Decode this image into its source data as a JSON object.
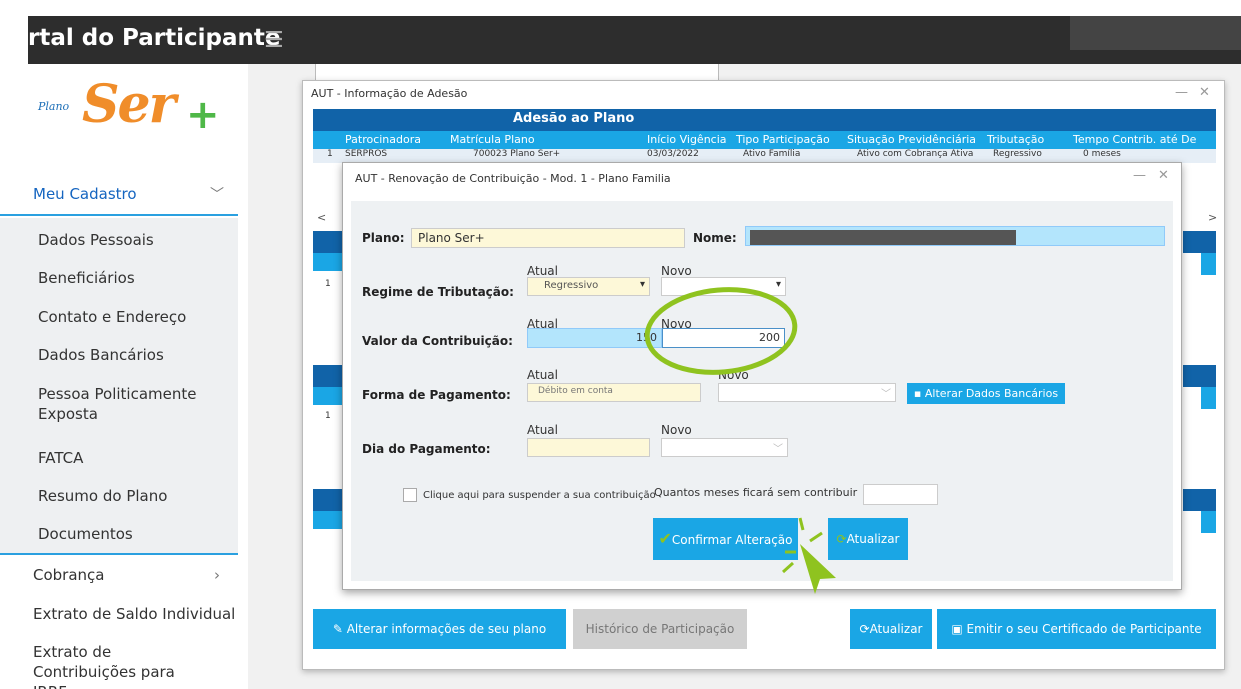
{
  "header": {
    "title": "rtal do Participante",
    "menu_icon": "hamburger-icon"
  },
  "logo": {
    "small": "Plano",
    "big": "Ser",
    "plus": "+"
  },
  "sidebar": {
    "section": "Meu Cadastro",
    "items": [
      "Dados Pessoais",
      "Beneficiários",
      "Contato e Endereço",
      "Dados Bancários",
      "Pessoa Politicamente Exposta",
      "FATCA",
      "Resumo do Plano",
      "Documentos"
    ],
    "cobranca": "Cobrança",
    "extrato_saldo": "Extrato de Saldo Individual",
    "extrato_contrib": "Extrato de Contribuições para IRRF"
  },
  "outer_window": {
    "title": "AUT - Informação de Adesão",
    "header": "Adesão ao Plano",
    "columns": [
      "Patrocinadora",
      "Matrícula Plano",
      "Início Vigência",
      "Tipo Participação",
      "Situação Previdênciária",
      "Tributação",
      "Tempo Contrib. até De"
    ],
    "row": [
      "1",
      "SERPROS",
      "700023 Plano Ser+",
      "03/03/2022",
      "Ativo Família",
      "Ativo com Cobrança Ativa",
      "Regressivo",
      "0 meses"
    ],
    "row_num_2": "1",
    "row_num_3": "1",
    "btn_alterar": "Alterar informações de seu plano",
    "btn_historico": "Histórico de Participação",
    "btn_atualizar": "Atualizar",
    "btn_certificado": "Emitir o seu Certificado de Participante"
  },
  "inner_window": {
    "title": "AUT - Renovação de Contribuição - Mod. 1 - Plano Familia",
    "plano_label": "Plano:",
    "plano_value": "Plano Ser+",
    "nome_label": "Nome:",
    "atual": "Atual",
    "novo": "Novo",
    "regime_label": "Regime de Tributação:",
    "regime_atual": "Regressivo",
    "valor_label": "Valor da Contribuição:",
    "valor_atual": "150",
    "valor_novo": "200",
    "forma_label": "Forma de Pagamento:",
    "forma_atual": "Débito em conta",
    "btn_alterar_bancarios": "Alterar Dados Bancários",
    "dia_label": "Dia do Pagamento:",
    "suspender_label": "Clique aqui para suspender a sua contribuição",
    "meses_label": "Quantos meses ficará sem contribuir",
    "btn_confirmar": "Confirmar Alteração",
    "btn_atualizar": "Atualizar"
  },
  "colors": {
    "accent": "#1aa6e5",
    "navy": "#1163a8",
    "highlight": "#8fc31f",
    "field_yellow": "#fdf8d8",
    "field_blue": "#b3e5fc"
  }
}
